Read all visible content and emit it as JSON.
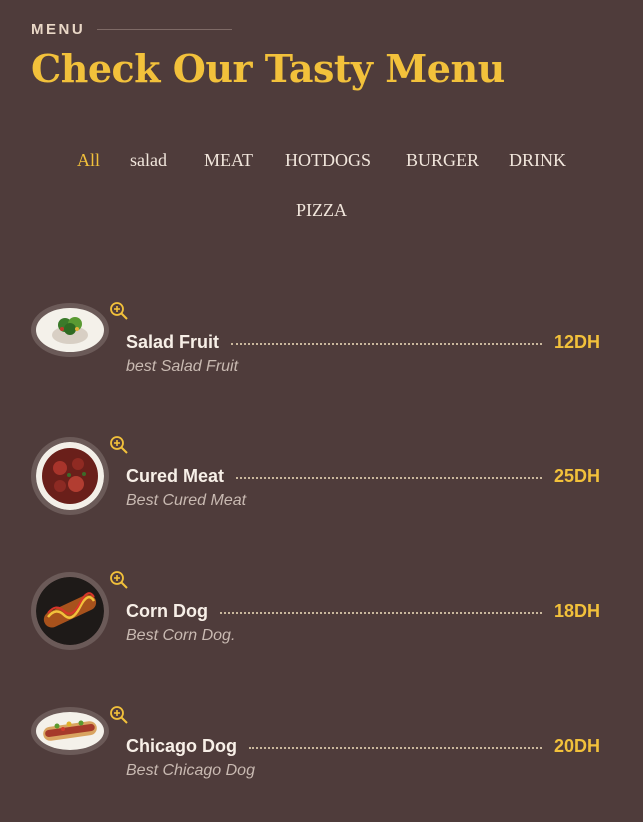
{
  "header": {
    "section_label": "MENU",
    "title": "Check Our Tasty Menu"
  },
  "filters": [
    "All",
    "salad",
    "MEAT",
    "HOTDOGS",
    "BURGER",
    "DRINK",
    "PIZZA"
  ],
  "items": [
    {
      "name": "Salad Fruit",
      "description": "best Salad Fruit",
      "price": "12DH"
    },
    {
      "name": "Cured Meat",
      "description": "Best Cured Meat",
      "price": "25DH"
    },
    {
      "name": "Corn Dog",
      "description": "Best Corn Dog.",
      "price": "18DH"
    },
    {
      "name": "Chicago Dog",
      "description": "Best Chicago Dog",
      "price": "20DH"
    }
  ],
  "colors": {
    "background": "#4f3c3b",
    "accent": "#f2c13b",
    "text": "#f7efe7"
  },
  "icons": {
    "zoom": "zoom-in-icon"
  }
}
